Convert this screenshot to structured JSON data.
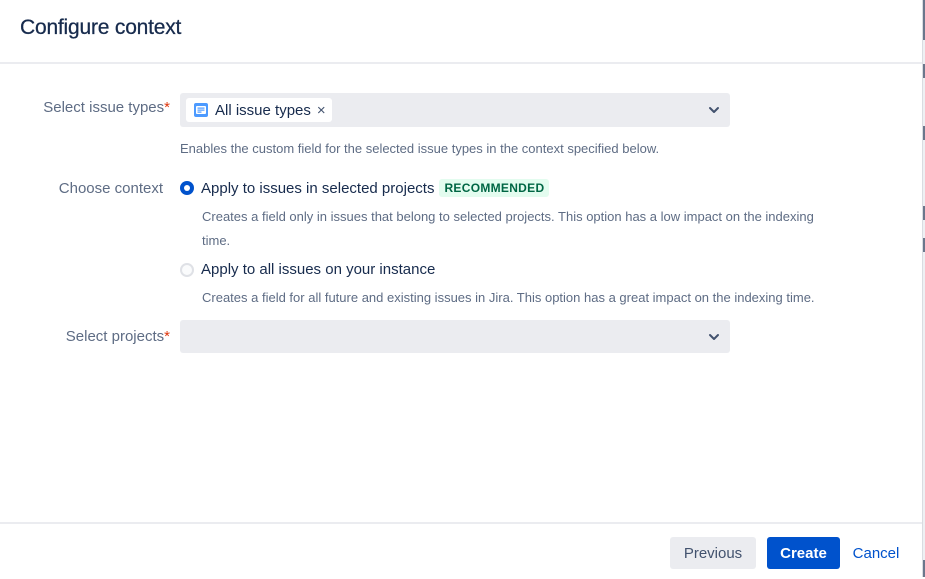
{
  "dialog": {
    "title": "Configure context"
  },
  "issue_types": {
    "label": "Select issue types",
    "required_marker": "*",
    "selected_tag": "All issue types",
    "remove_glyph": "×",
    "tag_icon": "issue-type-icon",
    "dropdown_icon": "chevron-down-icon",
    "help_text": "Enables the custom field for the selected issue types in the context specified below."
  },
  "context": {
    "label": "Choose context",
    "options": [
      {
        "label": "Apply to issues in selected projects",
        "badge": "RECOMMENDED",
        "selected": true,
        "description_line1": "Creates a field only in issues that belong to selected projects. This option has a low impact on the indexing",
        "description_line2": "time."
      },
      {
        "label": "Apply to all issues on your instance",
        "selected": false,
        "description_line1": "Creates a field for all future and existing issues in Jira. This option has a great impact on the indexing time."
      }
    ]
  },
  "projects": {
    "label": "Select projects",
    "required_marker": "*",
    "value": "",
    "dropdown_icon": "chevron-down-icon"
  },
  "footer": {
    "previous_label": "Previous",
    "create_label": "Create",
    "cancel_label": "Cancel"
  },
  "colors": {
    "primary": "#0052cc",
    "required": "#de350b",
    "recommended_bg": "#e3fcef",
    "recommended_text": "#006644",
    "field_bg": "#ebecf0"
  }
}
